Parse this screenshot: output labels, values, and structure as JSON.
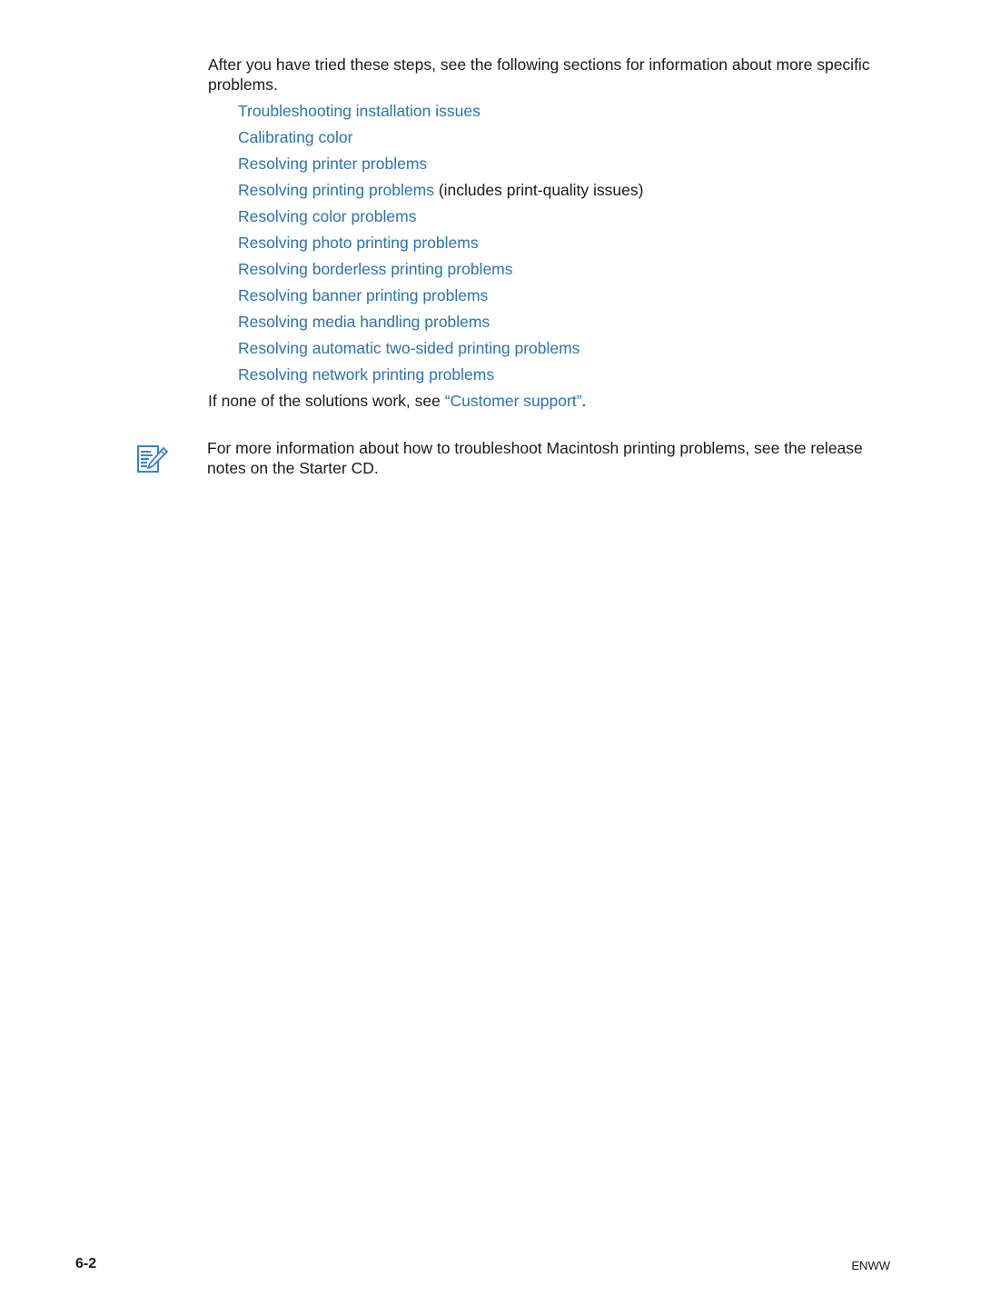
{
  "intro": "After you have tried these steps, see the following sections for information about more specific problems.",
  "links": [
    {
      "label": "Troubleshooting installation issues",
      "suffix": ""
    },
    {
      "label": "Calibrating color",
      "suffix": ""
    },
    {
      "label": "Resolving printer problems",
      "suffix": ""
    },
    {
      "label": "Resolving printing problems",
      "suffix": " (includes print-quality issues)"
    },
    {
      "label": "Resolving color problems",
      "suffix": ""
    },
    {
      "label": "Resolving photo printing problems",
      "suffix": ""
    },
    {
      "label": "Resolving borderless printing problems",
      "suffix": ""
    },
    {
      "label": "Resolving banner printing problems",
      "suffix": ""
    },
    {
      "label": "Resolving media handling problems",
      "suffix": ""
    },
    {
      "label": "Resolving automatic two-sided printing problems",
      "suffix": ""
    },
    {
      "label": "Resolving network printing problems",
      "suffix": ""
    }
  ],
  "fallback": {
    "prefix": "If none of the solutions work, see ",
    "link": "“Customer support”",
    "suffix": "."
  },
  "note": {
    "icon": "note-pencil-icon",
    "text": "For more information about how to troubleshoot Macintosh printing problems, see the release notes on the Starter CD."
  },
  "footer": {
    "page_number": "6-2",
    "label": "ENWW"
  },
  "colors": {
    "link": "#2a72b5",
    "text": "#1a1a1a",
    "icon": "#3b7fd6"
  }
}
